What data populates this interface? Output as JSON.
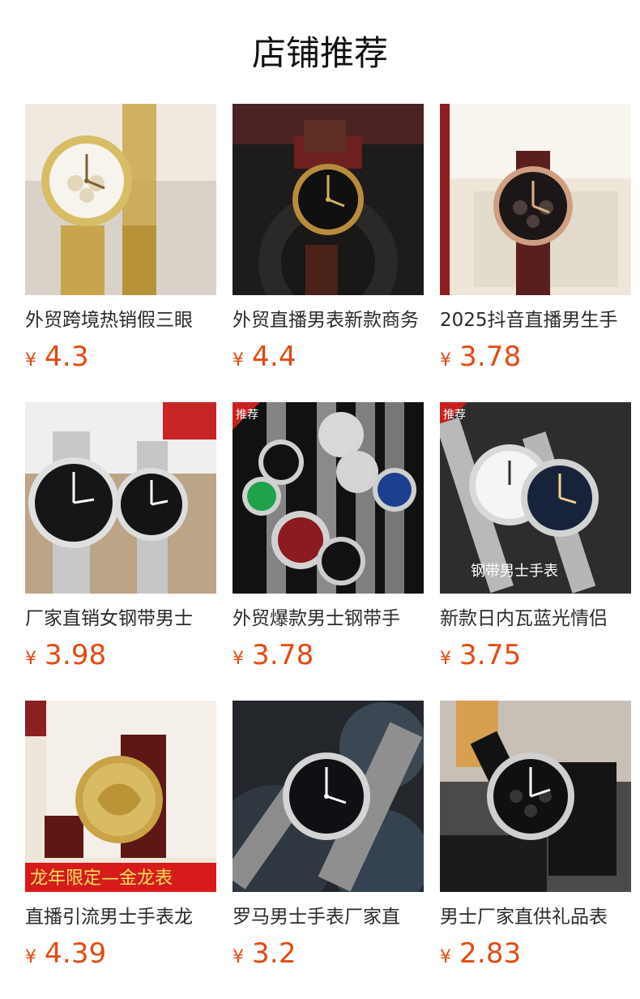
{
  "header": {
    "title": "店铺推荐"
  },
  "theme": {
    "price_color": "#e34a10",
    "title_color": "#2b2b2b"
  },
  "products": [
    {
      "title": "外贸跨境热销假三眼",
      "currency": "¥",
      "price": "4.3",
      "image_icon": "gold-watch-icon"
    },
    {
      "title": "外贸直播男表新款商务",
      "currency": "¥",
      "price": "4.4",
      "image_icon": "brown-leather-watch-icon"
    },
    {
      "title": "2025抖音直播男生手",
      "currency": "¥",
      "price": "3.78",
      "image_icon": "gift-box-watch-icon"
    },
    {
      "title": "厂家直销女钢带男士",
      "currency": "¥",
      "price": "3.98",
      "image_icon": "pair-silver-watch-icon"
    },
    {
      "title": "外贸爆款男士钢带手",
      "currency": "¥",
      "price": "3.78",
      "image_icon": "multi-color-watch-icon",
      "badge": "推荐"
    },
    {
      "title": "新款日内瓦蓝光情侣",
      "currency": "¥",
      "price": "3.75",
      "image_icon": "couple-silver-watch-icon",
      "badge": "推荐",
      "caption": "钢带男士手表"
    },
    {
      "title": "直播引流男士手表龙",
      "currency": "¥",
      "price": "4.39",
      "image_icon": "gold-dragon-watch-icon",
      "banner": "龙年限定—金龙表"
    },
    {
      "title": "罗马男士手表厂家直",
      "currency": "¥",
      "price": "3.2",
      "image_icon": "black-steel-watch-icon"
    },
    {
      "title": "男士厂家直供礼品表",
      "currency": "¥",
      "price": "2.83",
      "image_icon": "black-leather-watch-icon"
    }
  ]
}
